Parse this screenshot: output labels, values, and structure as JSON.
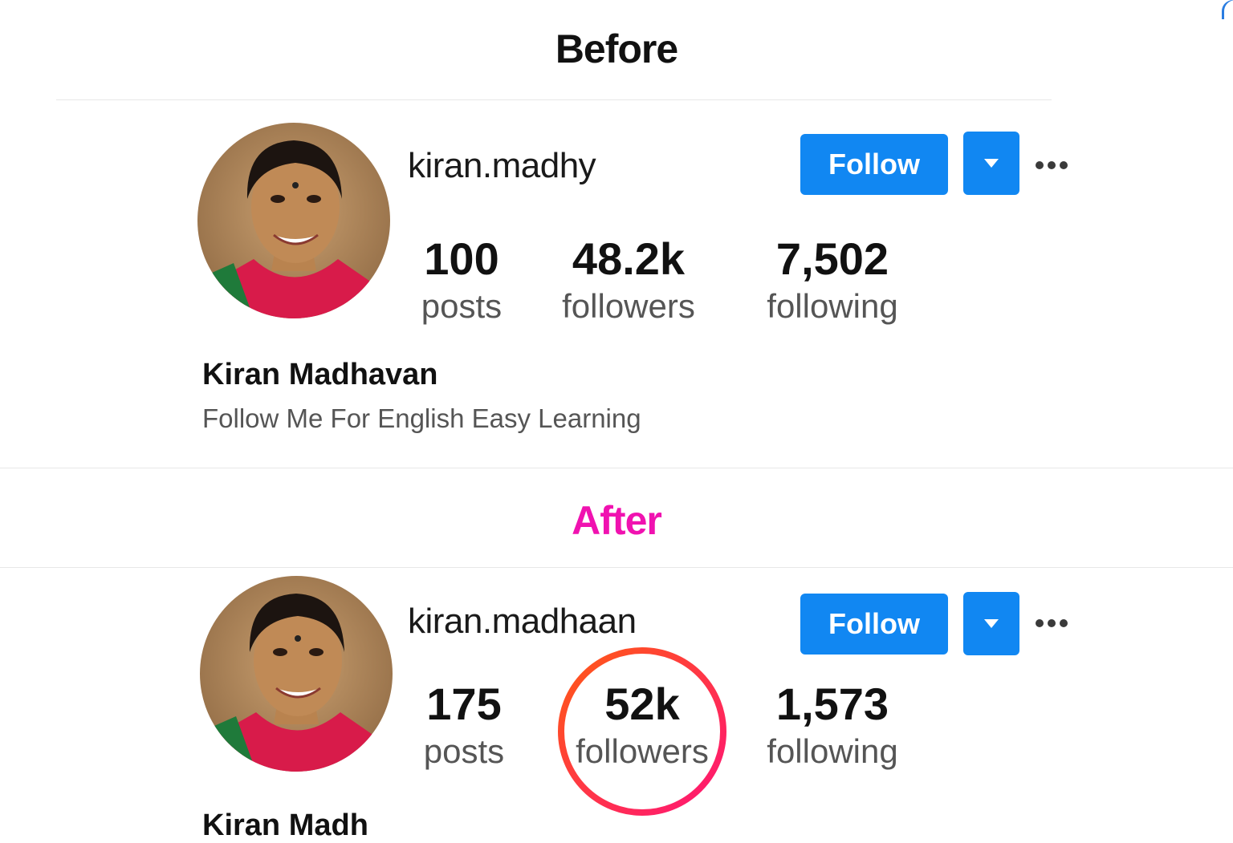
{
  "before": {
    "title": "Before",
    "username": "kiran.madhy",
    "follow_label": "Follow",
    "stats": {
      "posts": {
        "value": "100",
        "label": "posts"
      },
      "followers": {
        "value": "48.2k",
        "label": "followers"
      },
      "following": {
        "value": "7,502",
        "label": "following"
      }
    },
    "full_name": "Kiran Madhavan",
    "bio": "Follow Me For English Easy Learning"
  },
  "after": {
    "title": "After",
    "title_color": "#f012b0",
    "username": "kiran.madhaan",
    "follow_label": "Follow",
    "stats": {
      "posts": {
        "value": "175",
        "label": "posts"
      },
      "followers": {
        "value": "52k",
        "label": "followers"
      },
      "following": {
        "value": "1,573",
        "label": "following"
      }
    },
    "full_name_partial": "Kiran Madh"
  },
  "colors": {
    "follow_button": "#1187f2",
    "highlight_circle_start": "#ff5a14",
    "highlight_circle_end": "#ff1477"
  },
  "icons": [
    "avatar-photo",
    "chevron-down-icon",
    "more-options-icon",
    "highlight-circle"
  ]
}
